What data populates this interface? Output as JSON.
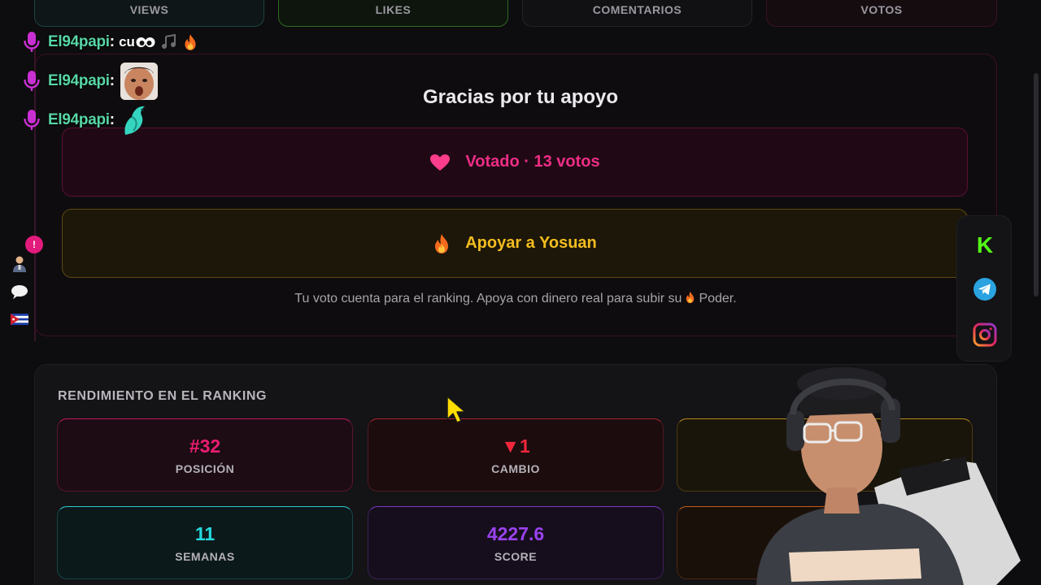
{
  "top_tabs": {
    "views": "VIEWS",
    "likes": "LIKES",
    "comments": "COMENTARIOS",
    "votes": "VOTOS"
  },
  "chat": {
    "messages": [
      {
        "user": "El94papi",
        "colon": ":",
        "text": "cu",
        "emote": "eyes-emote"
      },
      {
        "user": "El94papi",
        "colon": ":",
        "text": "",
        "emote": "face-emote"
      },
      {
        "user": "El94papi",
        "colon": ":",
        "text": "",
        "emote": "bird-emote"
      }
    ]
  },
  "support": {
    "title": "Gracias por tu apoyo",
    "voted_label": "Votado · 13 votos",
    "support_label": "Apoyar a Yosuan",
    "note_before": "Tu voto cuenta para el ranking. Apoya con dinero real para subir su",
    "note_after": "Poder."
  },
  "mini_sidebar": {
    "badge": "!"
  },
  "social": {
    "kick_letter": "K",
    "items": [
      "kick-icon",
      "telegram-icon",
      "instagram-icon"
    ]
  },
  "ranking": {
    "title": "RENDIMIENTO EN EL RANKING",
    "stats": [
      {
        "value": "#32",
        "label": "POSICIÓN"
      },
      {
        "value": "▼1",
        "label": "CAMBIO"
      },
      {
        "value": "",
        "label": ""
      },
      {
        "value": "11",
        "label": "SEMANAS"
      },
      {
        "value": "4227.6",
        "label": "SCORE"
      },
      {
        "value": "",
        "label": ""
      }
    ]
  },
  "colors": {
    "accent_pink": "#ee2d85",
    "accent_gold": "#f3bd1f",
    "chat_user": "#58d6a6",
    "weeks_cyan": "#24d9e0",
    "score_purple": "#9a42f0"
  }
}
